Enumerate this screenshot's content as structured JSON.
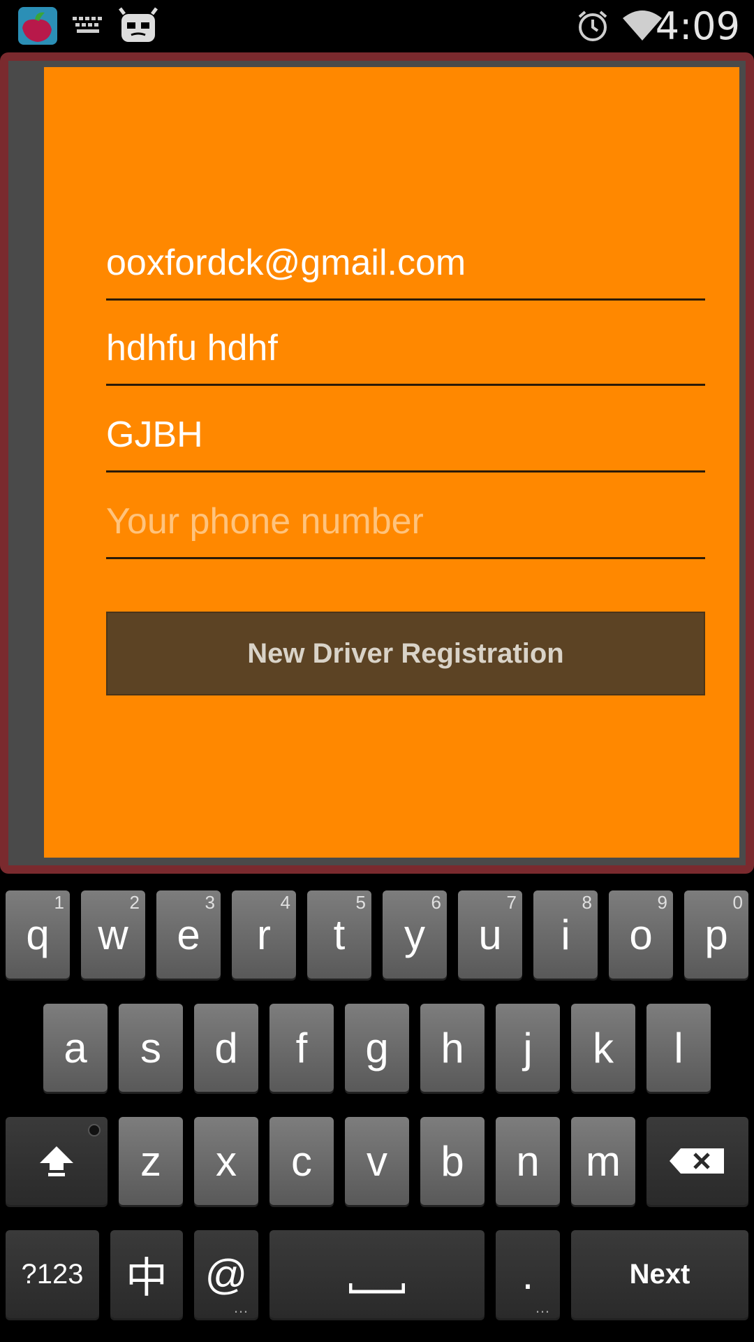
{
  "status_bar": {
    "time": "4:09",
    "left_icons": [
      "app-icon",
      "keyboard-icon",
      "android-debug-icon"
    ],
    "right_icons": [
      "alarm-icon",
      "wifi-icon"
    ]
  },
  "form": {
    "fields": [
      {
        "value": "ooxfordck@gmail.com",
        "placeholder": ""
      },
      {
        "value": "hdhfu hdhf",
        "placeholder": ""
      },
      {
        "value": "GJBH",
        "placeholder": ""
      },
      {
        "value": "",
        "placeholder": "Your phone number"
      }
    ],
    "register_button": "New Driver Registration"
  },
  "keyboard": {
    "row1": [
      "q",
      "w",
      "e",
      "r",
      "t",
      "y",
      "u",
      "i",
      "o",
      "p"
    ],
    "row1_hints": [
      "1",
      "2",
      "3",
      "4",
      "5",
      "6",
      "7",
      "8",
      "9",
      "0"
    ],
    "row2": [
      "a",
      "s",
      "d",
      "f",
      "g",
      "h",
      "j",
      "k",
      "l"
    ],
    "row3": [
      "z",
      "x",
      "c",
      "v",
      "b",
      "n",
      "m"
    ],
    "symbols_key": "?123",
    "lang_key": "中",
    "at_key": "@",
    "period_key": ".",
    "next_key": "Next"
  },
  "colors": {
    "panel": "#ff8800",
    "button": "#5c4324",
    "frame": "#7a2a2e"
  }
}
